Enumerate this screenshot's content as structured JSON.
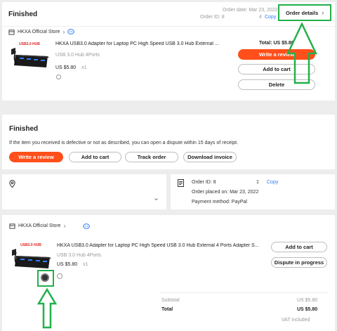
{
  "top_card": {
    "status": "Finished",
    "order_date": "Order date: Mar 23, 2022",
    "order_id": "Order ID: 8",
    "order_id_tail": "4",
    "copy": "Copy",
    "order_details": "Order details",
    "store": "HKXA Official Store",
    "product_title": "HKXA USB3.0 Adapter for Laptop PC High Speed USB 3.0 Hub External ...",
    "product_variant": "USB 3.0 Hub 4Ports",
    "price": "US $5.80",
    "qty": "x1",
    "total": "Total: US $5.80",
    "write_review": "Write a review",
    "add_to_cart": "Add to cart",
    "delete": "Delete",
    "image_label": "USB3.0 HUB"
  },
  "detail": {
    "status": "Finished",
    "notice": "If the item you received is defective or not as described, you can open a dispute within 15 days of receipt.",
    "buttons": [
      "Write a review",
      "Add to cart",
      "Track order",
      "Download invoice"
    ],
    "order_id": "Order ID: 8",
    "order_id_tail": "1",
    "copy": "Copy",
    "placed_on": "Order placed on: Mar 23, 2022",
    "payment": "Payment method: PayPal"
  },
  "store_section": {
    "store": "HKXA Official Store",
    "product_title": "HKXA USB3.0 Adapter for Laptop PC High Speed USB 3.0 Hub External 4 Ports Adapter S...",
    "product_variant": "USB 3.0 Hub 4Ports",
    "price": "US $5.80",
    "qty": "x1",
    "add_to_cart": "Add to cart",
    "dispute": "Dispute in progress",
    "image_label": "USB3.0 HUB"
  },
  "summary": {
    "subtotal_label": "Subtotal",
    "subtotal_value": "US $5.80",
    "total_label": "Total",
    "total_value": "US $5.80",
    "vat": "VAT included"
  },
  "colors": {
    "accent": "#ff4f1a",
    "link": "#2e7df6",
    "annotation": "#22b04b"
  }
}
